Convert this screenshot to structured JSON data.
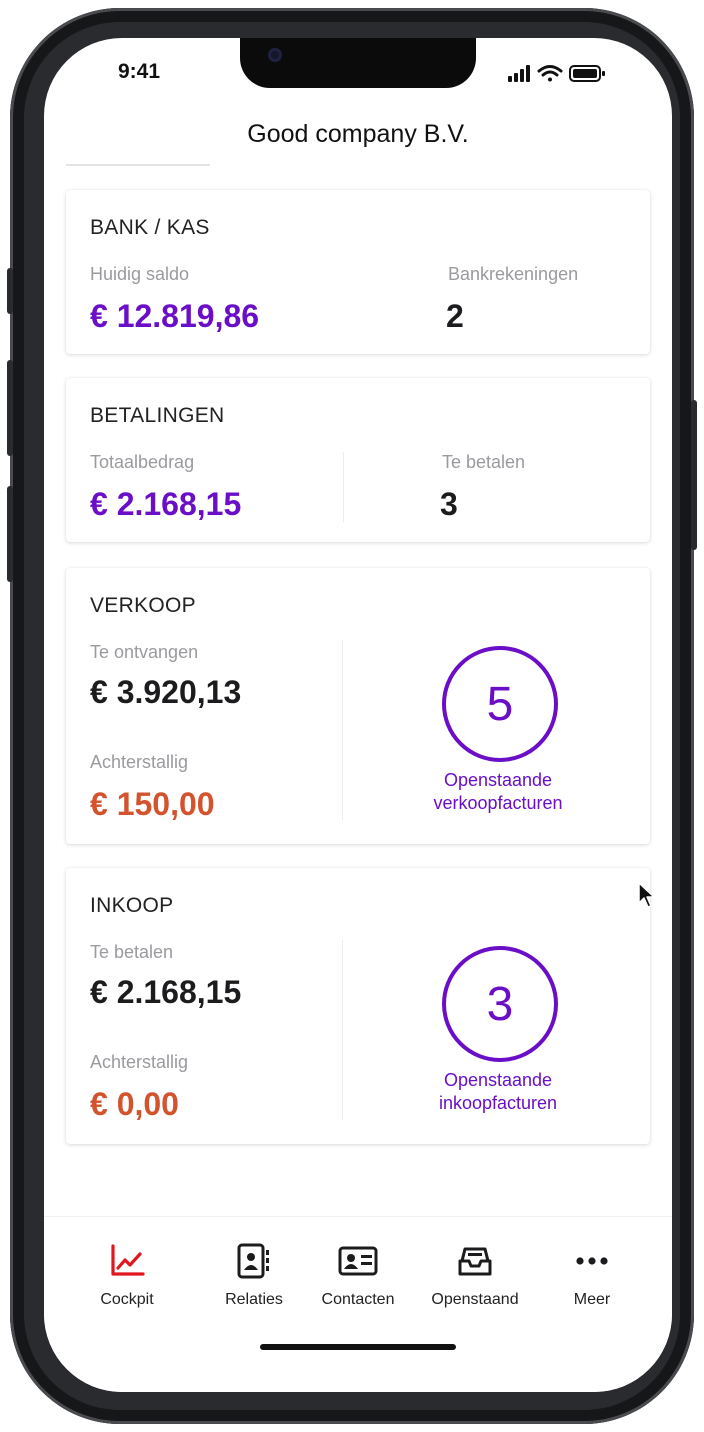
{
  "status_bar": {
    "time": "9:41"
  },
  "header": {
    "title": "Good company B.V."
  },
  "bank_card": {
    "title": "BANK / KAS",
    "balance_label": "Huidig saldo",
    "balance_value": "€ 12.819,86",
    "accounts_label": "Bankrekeningen",
    "accounts_value": "2"
  },
  "payments_card": {
    "title": "BETALINGEN",
    "total_label": "Totaalbedrag",
    "total_value": "€ 2.168,15",
    "topay_label": "Te betalen",
    "topay_value": "3"
  },
  "sales_card": {
    "title": "VERKOOP",
    "receive_label": "Te ontvangen",
    "receive_value": "€ 3.920,13",
    "overdue_label": "Achterstallig",
    "overdue_value": "€ 150,00",
    "open_count": "5",
    "open_caption_line1": "Openstaande",
    "open_caption_line2": "verkoopfacturen"
  },
  "purchase_card": {
    "title": "INKOOP",
    "pay_label": "Te betalen",
    "pay_value": "€ 2.168,15",
    "overdue_label": "Achterstallig",
    "overdue_value": "€ 0,00",
    "open_count": "3",
    "open_caption_line1": "Openstaande",
    "open_caption_line2": "inkoopfacturen"
  },
  "tabbar": {
    "items": [
      {
        "label": "Cockpit",
        "icon": "chart-line-icon",
        "active": true
      },
      {
        "label": "Relaties",
        "icon": "address-book-icon",
        "active": false
      },
      {
        "label": "Contacten",
        "icon": "contact-card-icon",
        "active": false
      },
      {
        "label": "Openstaand",
        "icon": "inbox-tray-icon",
        "active": false
      },
      {
        "label": "Meer",
        "icon": "more-dots-icon",
        "active": false
      }
    ]
  },
  "colors": {
    "accent": "#6a0fc7",
    "overdue": "#d2532e",
    "active_tab": "#e0171f"
  }
}
